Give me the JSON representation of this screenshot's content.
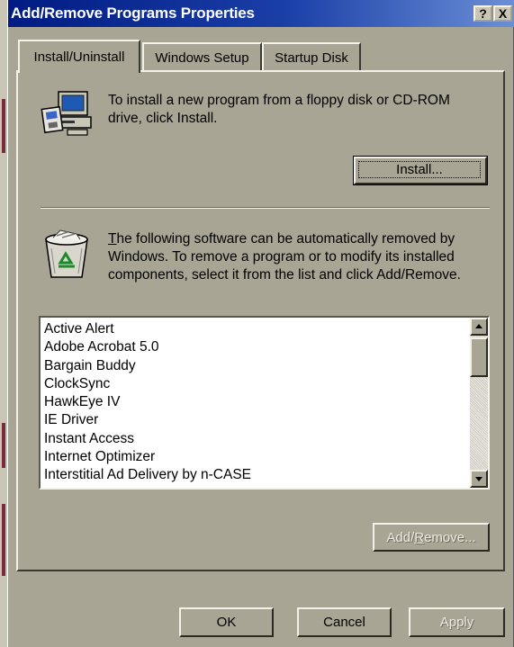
{
  "window": {
    "title": "Add/Remove Programs Properties",
    "help_label": "?",
    "close_label": "X"
  },
  "tabs": [
    {
      "label": "Install/Uninstall",
      "active": true
    },
    {
      "label": "Windows Setup",
      "active": false
    },
    {
      "label": "Startup Disk",
      "active": false
    }
  ],
  "install": {
    "description": "To install a new program from a floppy disk or CD-ROM drive, click Install.",
    "button_label": "Install...",
    "icon": "computer-with-disk-icon"
  },
  "remove": {
    "description_first_char": "T",
    "description_rest": "he following software can be automatically removed by Windows. To remove a program or to modify its installed components, select it from the list and click Add/Remove.",
    "icon": "recycle-bin-icon",
    "programs": [
      "Active Alert",
      "Adobe Acrobat 5.0",
      "Bargain Buddy",
      "ClockSync",
      "HawkEye IV",
      "IE Driver",
      "Instant Access",
      "Internet Optimizer",
      "Interstitial Ad Delivery by n-CASE"
    ],
    "add_remove_prefix": "Add/",
    "add_remove_accel": "R",
    "add_remove_suffix": "emove..."
  },
  "footer": {
    "ok_label": "OK",
    "cancel_label": "Cancel",
    "apply_label": "Apply"
  },
  "colors": {
    "title_bar": "#001b83",
    "face": "#a8a594"
  }
}
